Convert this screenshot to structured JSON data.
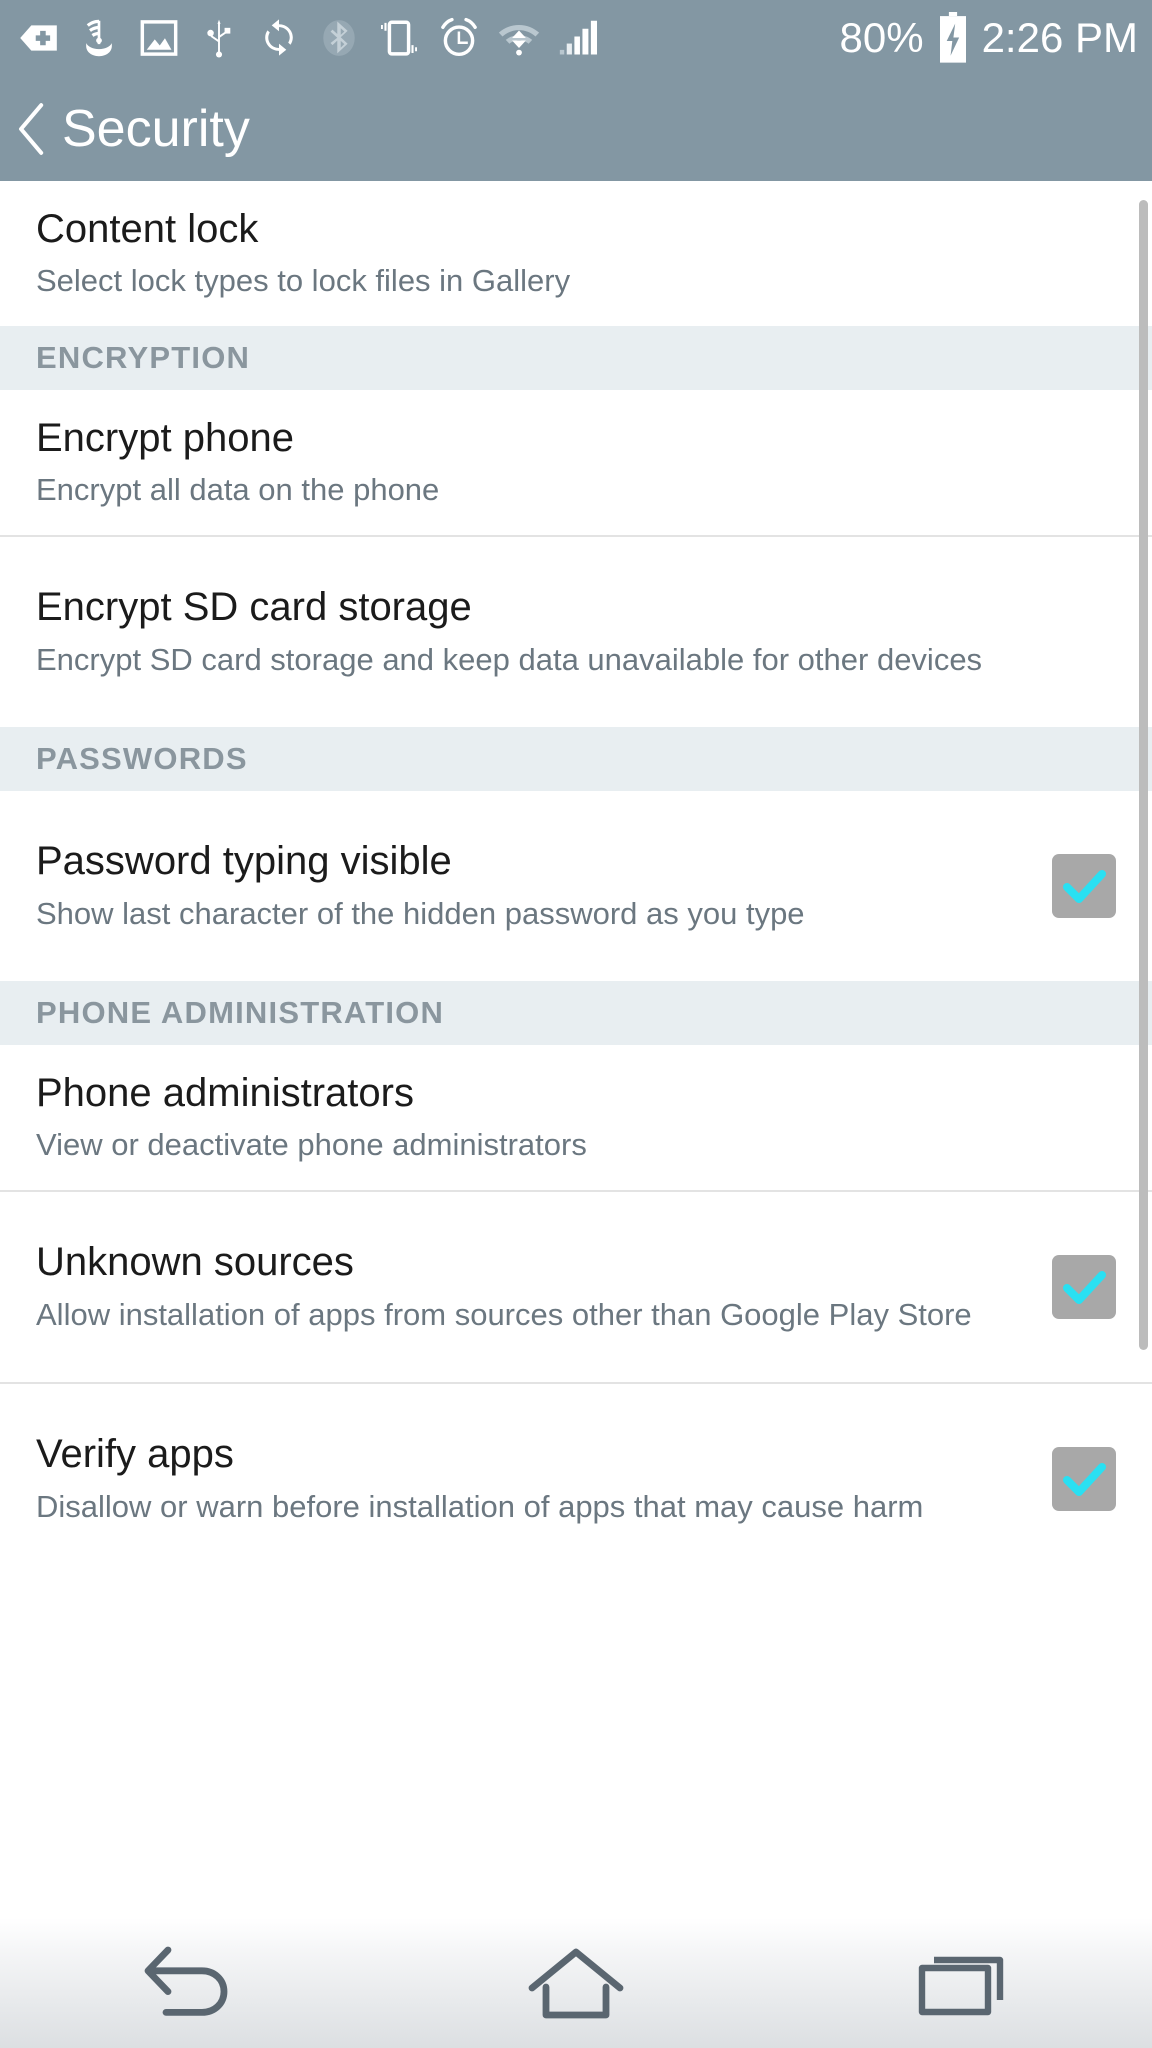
{
  "statusbar": {
    "icons": [
      {
        "name": "medical-plus-tag-icon"
      },
      {
        "name": "wifi-calling-icon"
      },
      {
        "name": "screenshot-image-icon"
      },
      {
        "name": "usb-icon"
      },
      {
        "name": "sync-icon"
      },
      {
        "name": "bluetooth-icon"
      },
      {
        "name": "vibrate-icon"
      },
      {
        "name": "alarm-icon"
      },
      {
        "name": "wifi-icon"
      },
      {
        "name": "cellular-signal-icon"
      }
    ],
    "battery_percent": "80%",
    "battery_icon": "battery-charging-icon",
    "time": "2:26 PM"
  },
  "actionbar": {
    "back_icon": "chevron-left-icon",
    "title": "Security"
  },
  "colors": {
    "header_bg": "#8397a3",
    "section_header_bg": "#e8eef1",
    "section_header_text": "#8a969e",
    "row_title": "#1b1b1b",
    "row_subtitle": "#6b7780",
    "checkbox_box": "#a8a8a8",
    "checkbox_check": "#2ae0f2",
    "navbar_icon": "#5a6670",
    "scrollbar": "#bcbcbc"
  },
  "list": [
    {
      "kind": "item",
      "name": "content-lock",
      "title": "Content lock",
      "subtitle": "Select lock types to lock files in Gallery",
      "checkbox": null
    },
    {
      "kind": "section",
      "name": "encryption",
      "title": "ENCRYPTION"
    },
    {
      "kind": "item",
      "name": "encrypt-phone",
      "title": "Encrypt phone",
      "subtitle": "Encrypt all data on the phone",
      "checkbox": null,
      "divider_after": true
    },
    {
      "kind": "item",
      "name": "encrypt-sd-card-storage",
      "title": "Encrypt SD card storage",
      "subtitle": "Encrypt SD card storage and keep data unavailable for other devices",
      "checkbox": null
    },
    {
      "kind": "section",
      "name": "passwords",
      "title": "PASSWORDS"
    },
    {
      "kind": "item",
      "name": "password-typing-visible",
      "title": "Password typing visible",
      "subtitle": "Show last character of the hidden password as you type",
      "checkbox": "checked"
    },
    {
      "kind": "section",
      "name": "phone-administration",
      "title": "PHONE ADMINISTRATION"
    },
    {
      "kind": "item",
      "name": "phone-administrators",
      "title": "Phone administrators",
      "subtitle": "View or deactivate phone administrators",
      "checkbox": null,
      "divider_after": true
    },
    {
      "kind": "item",
      "name": "unknown-sources",
      "title": "Unknown sources",
      "subtitle": "Allow installation of apps from sources other than Google Play Store",
      "checkbox": "checked",
      "divider_after": true
    },
    {
      "kind": "item",
      "name": "verify-apps",
      "title": "Verify apps",
      "subtitle": "Disallow or warn before installation of apps that may cause harm",
      "checkbox": "checked"
    }
  ],
  "navbar": {
    "buttons": [
      {
        "name": "nav-back-button",
        "icon": "back-arrow-icon"
      },
      {
        "name": "nav-home-button",
        "icon": "home-icon"
      },
      {
        "name": "nav-recents-button",
        "icon": "recent-apps-icon"
      }
    ]
  }
}
